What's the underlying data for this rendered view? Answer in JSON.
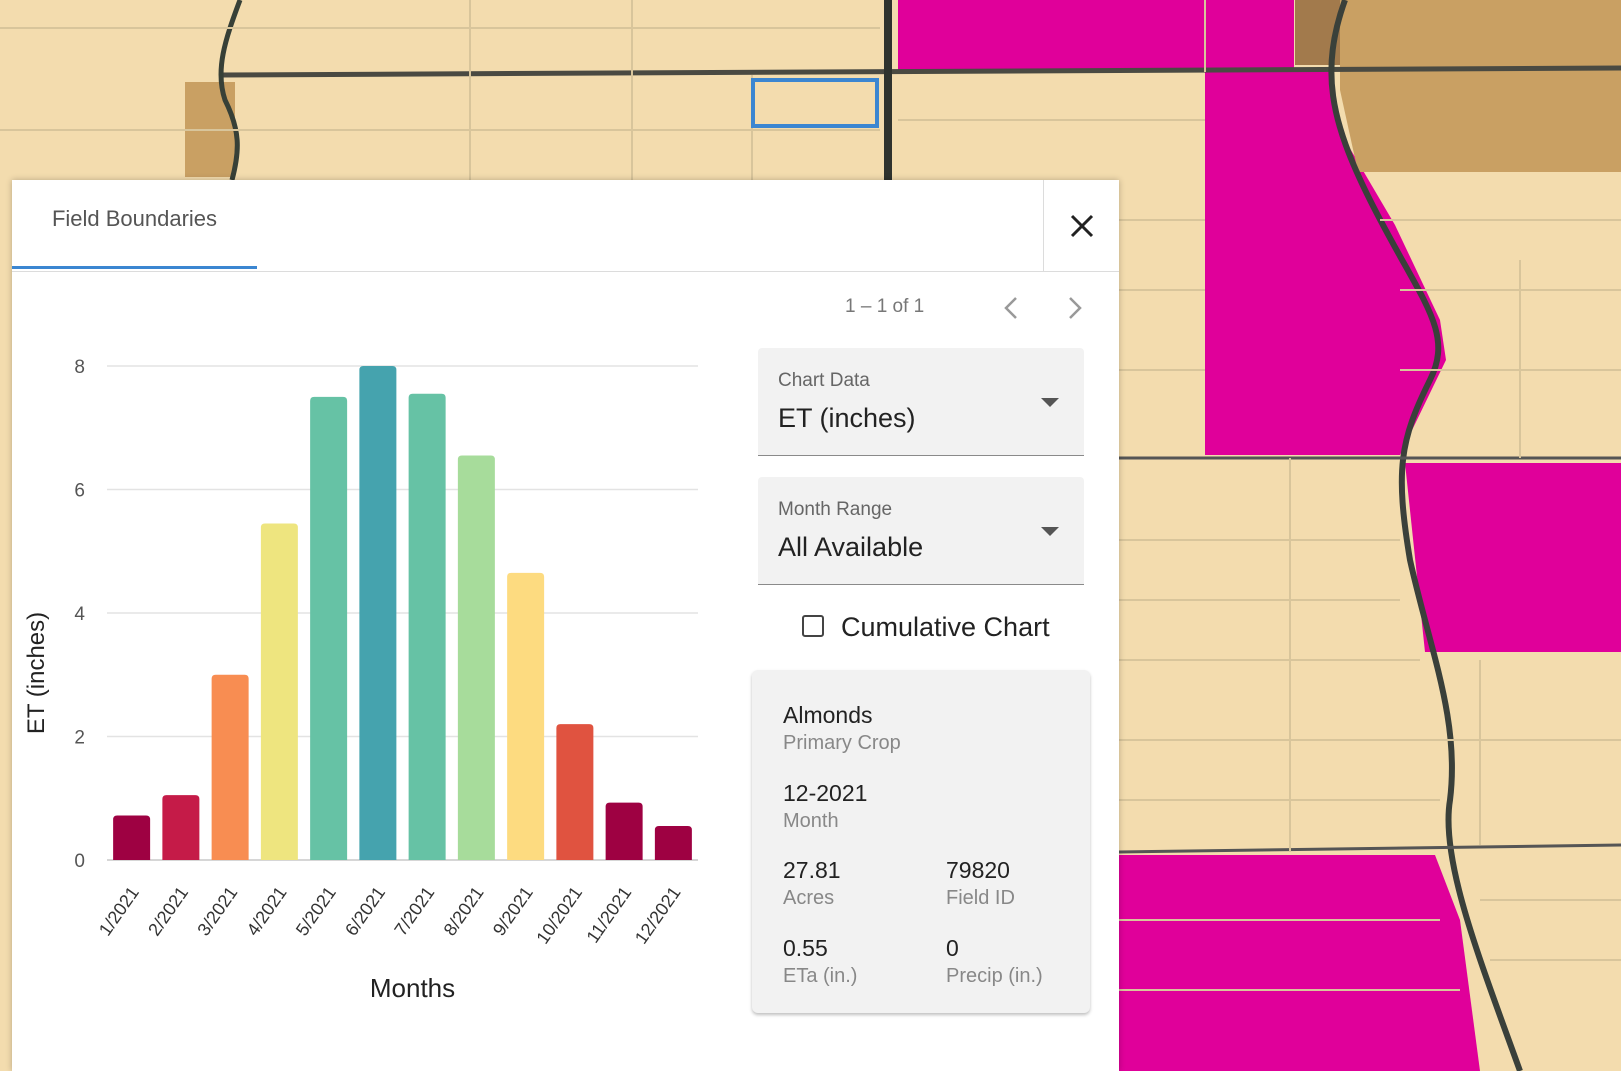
{
  "panel": {
    "tab_label": "Field Boundaries"
  },
  "pager": {
    "text": "1 – 1 of 1"
  },
  "controls": {
    "chart_data_label": "Chart Data",
    "chart_data_value": "ET (inches)",
    "month_range_label": "Month Range",
    "month_range_value": "All Available",
    "cumulative_label": "Cumulative Chart",
    "cumulative_checked": false
  },
  "info": {
    "crop_value": "Almonds",
    "crop_label": "Primary Crop",
    "month_value": "12-2021",
    "month_label": "Month",
    "acres_value": "27.81",
    "acres_label": "Acres",
    "field_id_value": "79820",
    "field_id_label": "Field ID",
    "eta_value": "0.55",
    "eta_label": "ETa (in.)",
    "precip_value": "0",
    "precip_label": "Precip (in.)"
  },
  "colors": {
    "accent": "#3b86d1",
    "map_fields": "#f3dcae",
    "map_crop_highlight": "#e0009a",
    "map_brown": "#c9a063"
  },
  "chart_data": {
    "type": "bar",
    "categories": [
      "1/2021",
      "2/2021",
      "3/2021",
      "4/2021",
      "5/2021",
      "6/2021",
      "7/2021",
      "8/2021",
      "9/2021",
      "10/2021",
      "11/2021",
      "12/2021"
    ],
    "values": [
      0.72,
      1.05,
      3.0,
      5.45,
      7.5,
      8.0,
      7.55,
      6.55,
      4.65,
      2.2,
      0.93,
      0.55
    ],
    "colors": [
      "#9e0142",
      "#c51b48",
      "#f88d52",
      "#eee57f",
      "#66c2a5",
      "#45a3ae",
      "#66c2a5",
      "#a7dc9b",
      "#fddb80",
      "#e05340",
      "#9e0142",
      "#9e0142"
    ],
    "xlabel": "Months",
    "ylabel": "ET (inches)",
    "yticks": [
      0,
      2,
      4,
      6,
      8
    ],
    "ylim": [
      0,
      8
    ],
    "grid": true
  }
}
